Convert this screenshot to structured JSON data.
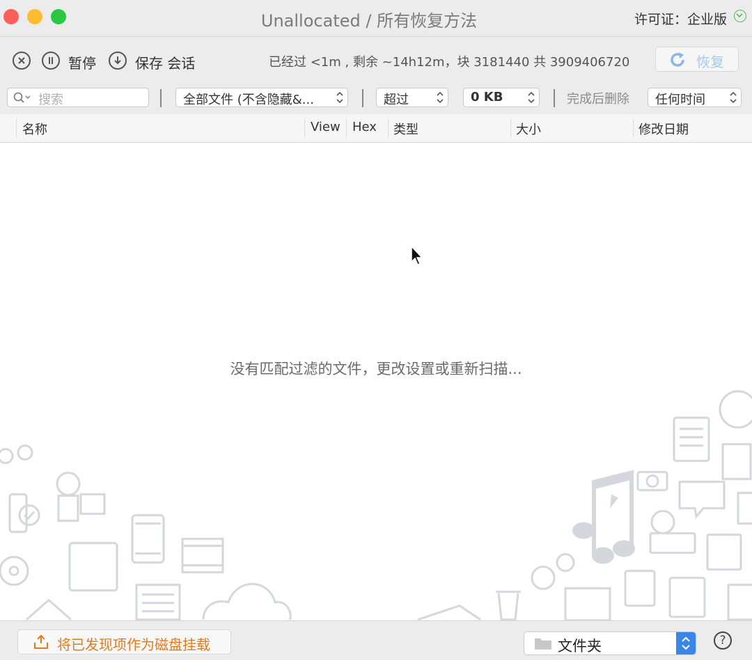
{
  "window": {
    "title": "Unallocated / 所有恢复方法",
    "license": "许可证：企业版"
  },
  "toolbar": {
    "pause_label": "暂停",
    "save_session_label": "保存 会话",
    "status": "已经过 <1m , 剩余 ~14h12m，块 3181440 共 3909406720",
    "recover_label": "恢复"
  },
  "filters": {
    "search_placeholder": "搜索",
    "file_filter": "全部文件 (不含隐藏&...",
    "size_comparison": "超过",
    "size_value": "0 KB",
    "delete_after_label": "完成后删除",
    "time_filter": "任何时间"
  },
  "columns": [
    "名称",
    "View",
    "Hex",
    "类型",
    "大小",
    "修改日期"
  ],
  "empty_message": "没有匹配过滤的文件，更改设置或重新扫描...",
  "bottom": {
    "mount_label": "将已发现项作为磁盘挂载",
    "folder_label": "文件夹"
  },
  "colors": {
    "accent": "#3a86e8",
    "mount_orange": "#e07a1f",
    "close": "#fe5f57",
    "minimize": "#febc2e",
    "maximize": "#28c840"
  },
  "icons": [
    "close-circle-icon",
    "pause-icon",
    "download-icon",
    "refresh-icon",
    "search-icon",
    "folder-icon",
    "help-icon",
    "cursor-icon"
  ]
}
